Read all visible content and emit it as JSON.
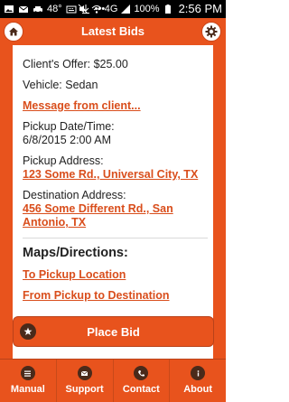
{
  "status_bar": {
    "battery_temp": "48°",
    "network": "4G",
    "battery_percent": "100%",
    "time": "2:56 PM"
  },
  "header": {
    "title": "Latest Bids",
    "home_icon": "home-icon",
    "settings_icon": "gear-icon"
  },
  "details": {
    "clients_offer": "Client's Offer: $25.00",
    "vehicle_label": "Vehicle:",
    "vehicle_value": "Sedan",
    "message_link": "Message from client...",
    "pickup_datetime_label": "Pickup Date/Time:",
    "pickup_datetime_value": "6/8/2015 2:00 AM",
    "pickup_address_label": "Pickup Address:",
    "pickup_address_value": "123 Some Rd., Universal City, TX",
    "destination_label": "Destination Address:",
    "destination_value_line1": "456 Some Different Rd., San",
    "destination_value_line2": "Antonio, TX"
  },
  "maps": {
    "heading": "Maps/Directions:",
    "to_pickup": "To Pickup Location",
    "pickup_to_dest": "From Pickup to Destination"
  },
  "actions": {
    "place_bid": "Place Bid"
  },
  "tabs": [
    {
      "label": "Manual",
      "icon": "menu-icon"
    },
    {
      "label": "Support",
      "icon": "mail-icon"
    },
    {
      "label": "Contact",
      "icon": "phone-icon"
    },
    {
      "label": "About",
      "icon": "info-icon"
    }
  ],
  "colors": {
    "accent": "#e8531d",
    "link": "#d94e1c",
    "icon_dark": "#4a2a1a"
  }
}
